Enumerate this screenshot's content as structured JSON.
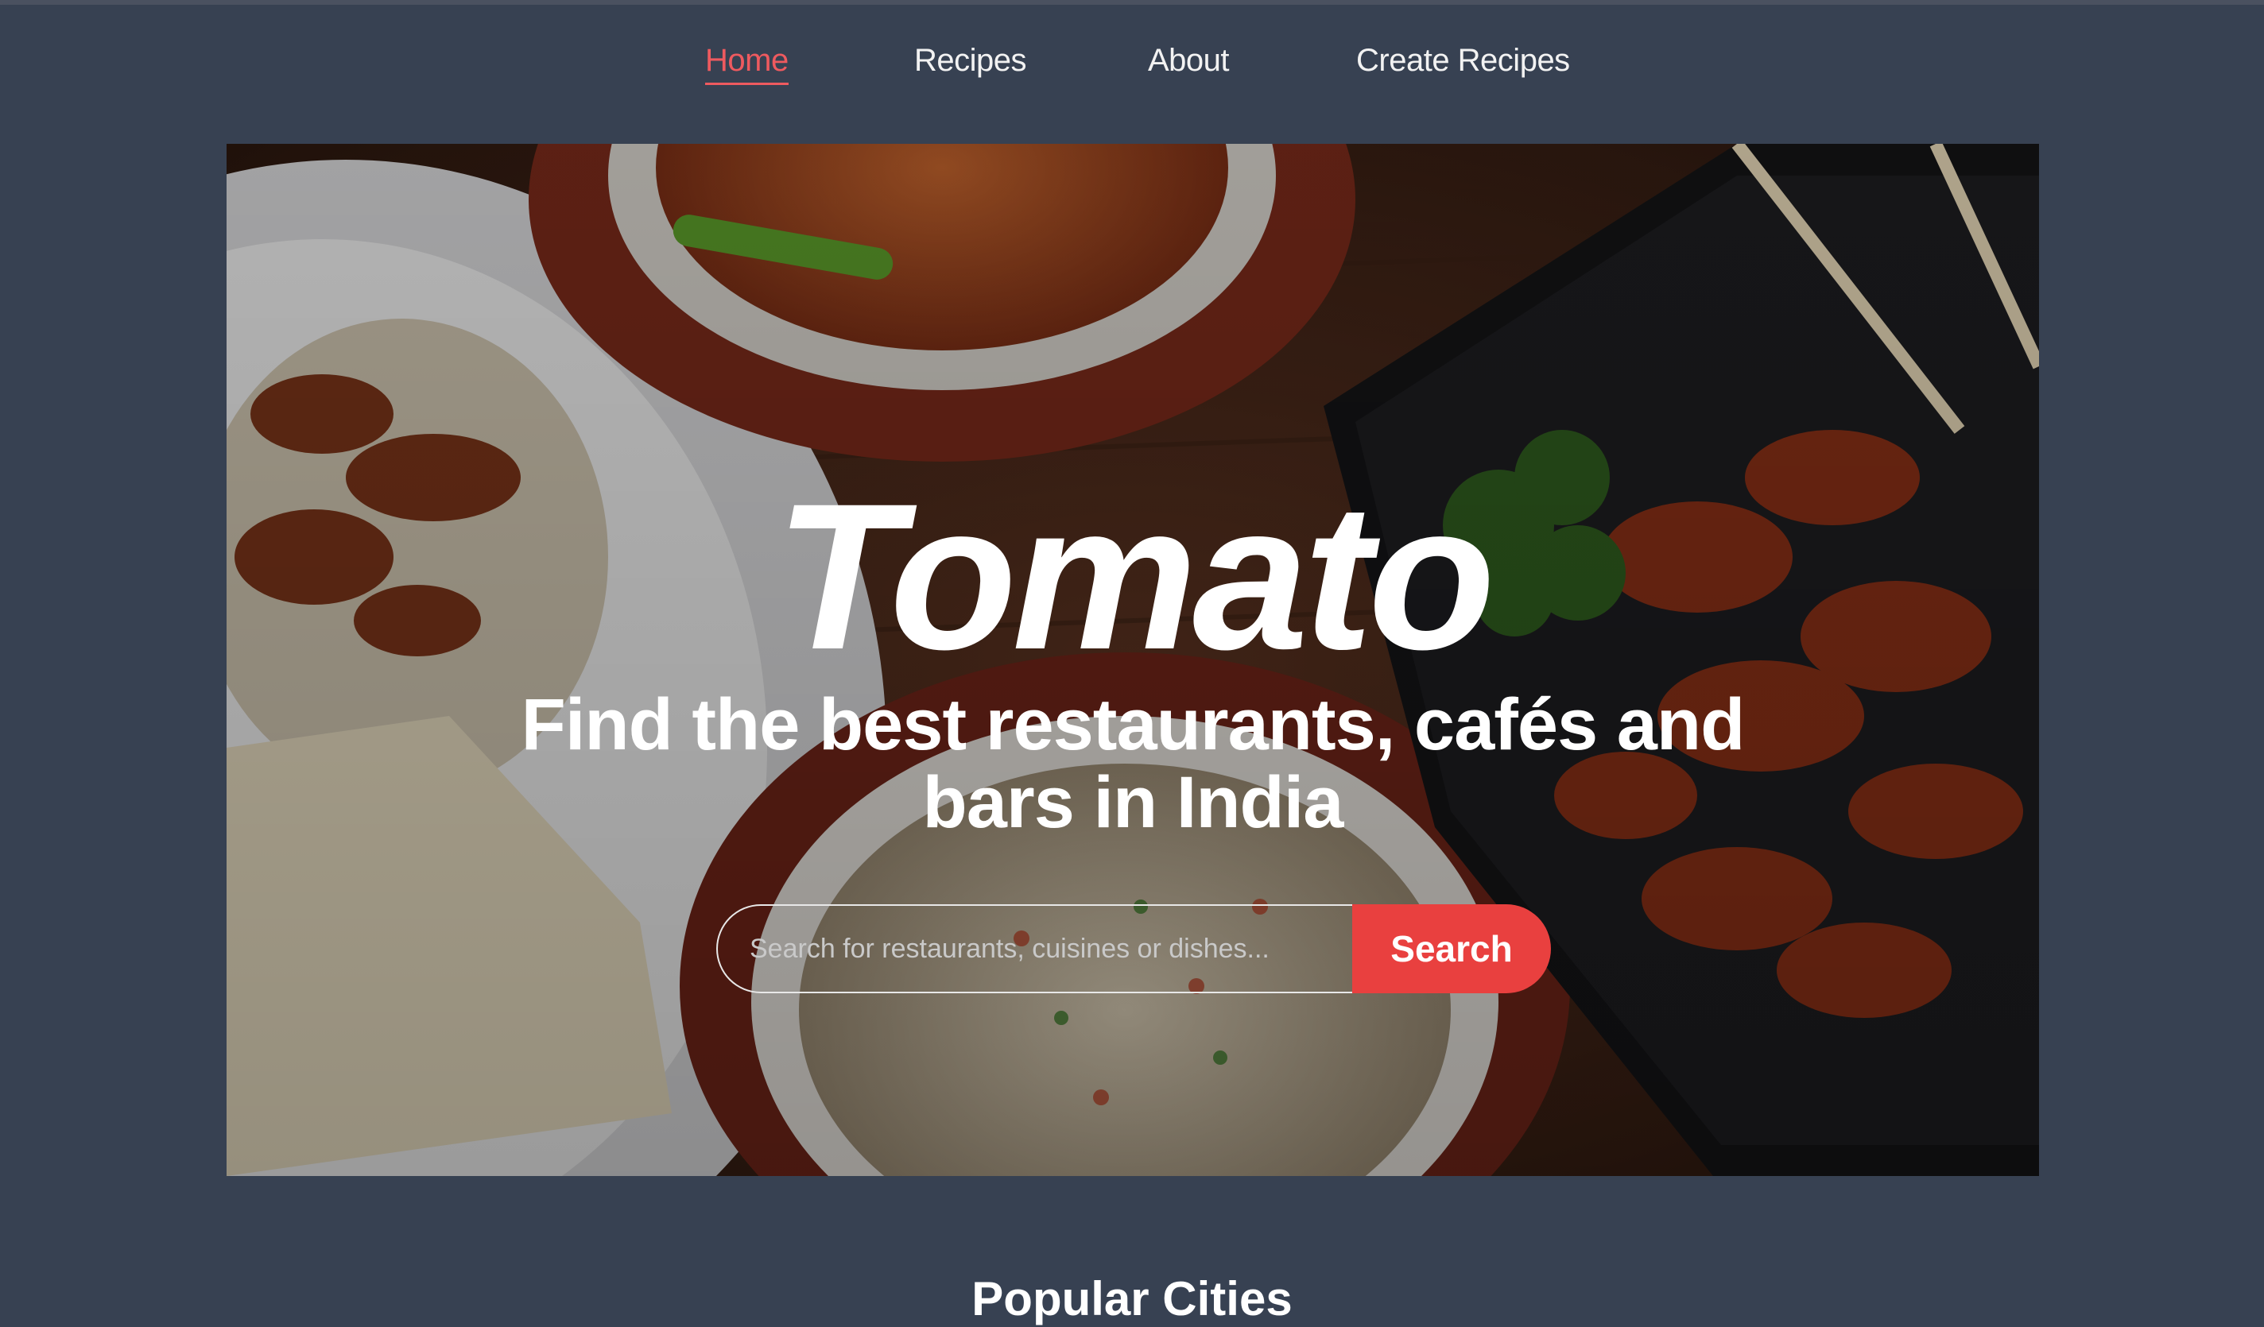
{
  "nav": {
    "items": [
      {
        "label": "Home",
        "active": true
      },
      {
        "label": "Recipes",
        "active": false
      },
      {
        "label": "About",
        "active": false
      },
      {
        "label": "Create Recipes",
        "active": false
      }
    ]
  },
  "hero": {
    "brand": "Tomato",
    "tagline_line1": "Find the best restaurants, cafés and",
    "tagline_line2": "bars in India",
    "search": {
      "placeholder": "Search for restaurants, cuisines or dishes...",
      "value": "",
      "button_label": "Search"
    }
  },
  "section": {
    "title": "Popular Cities"
  },
  "colors": {
    "page_background": "#374152",
    "accent": "#e9403f",
    "active_nav": "#ee5a5f"
  }
}
